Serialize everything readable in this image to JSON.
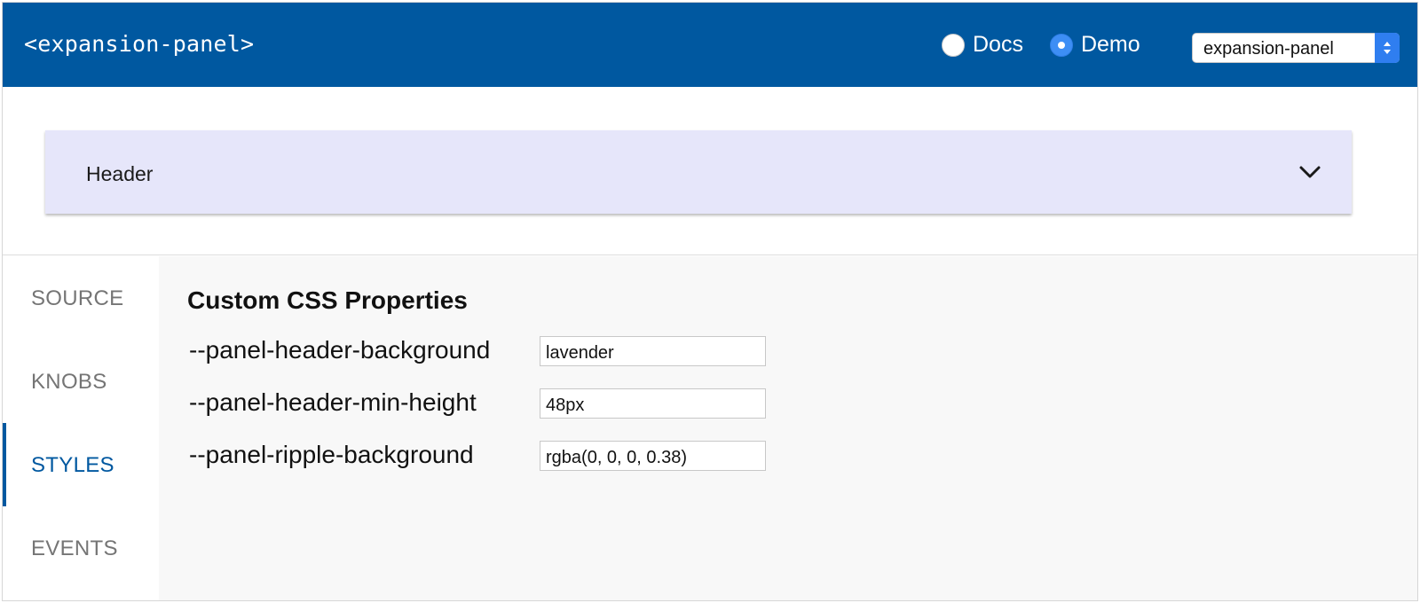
{
  "app": {
    "title": "<expansion-panel>"
  },
  "view_toggle": {
    "options": [
      {
        "label": "Docs",
        "checked": false
      },
      {
        "label": "Demo",
        "checked": true
      }
    ]
  },
  "component_select": {
    "selected": "expansion-panel"
  },
  "demo": {
    "panel_header_label": "Header",
    "panel_header_background": "#e6e6fa",
    "expand_icon": "chevron-down-icon"
  },
  "tabs": [
    {
      "label": "SOURCE",
      "active": false
    },
    {
      "label": "KNOBS",
      "active": false
    },
    {
      "label": "STYLES",
      "active": true
    },
    {
      "label": "EVENTS",
      "active": false
    }
  ],
  "styles_panel": {
    "title": "Custom CSS Properties",
    "properties": [
      {
        "name": "--panel-header-background",
        "value": "lavender"
      },
      {
        "name": "--panel-header-min-height",
        "value": "48px"
      },
      {
        "name": "--panel-ripple-background",
        "value": "rgba(0, 0, 0, 0.38)"
      }
    ]
  },
  "colors": {
    "brand": "#0058a0",
    "radio_accent": "#3d8ef5",
    "inactive_tab": "#757575"
  }
}
